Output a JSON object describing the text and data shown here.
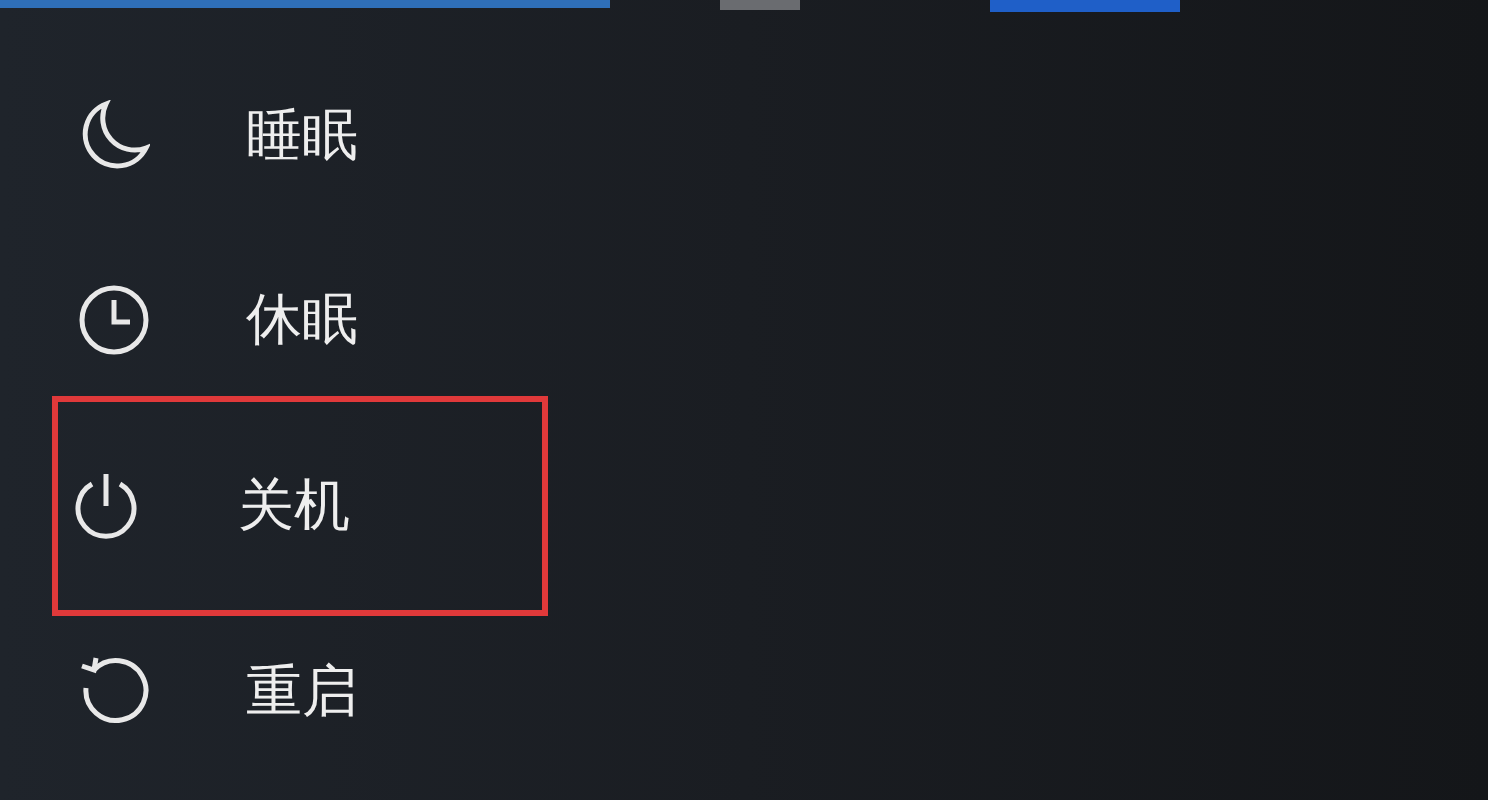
{
  "power_menu": {
    "items": [
      {
        "kind": "sleep",
        "label": "睡眠",
        "highlighted": false
      },
      {
        "kind": "hibernate",
        "label": "休眠",
        "highlighted": false
      },
      {
        "kind": "shutdown",
        "label": "关机",
        "highlighted": true
      },
      {
        "kind": "restart",
        "label": "重启",
        "highlighted": false
      }
    ]
  }
}
